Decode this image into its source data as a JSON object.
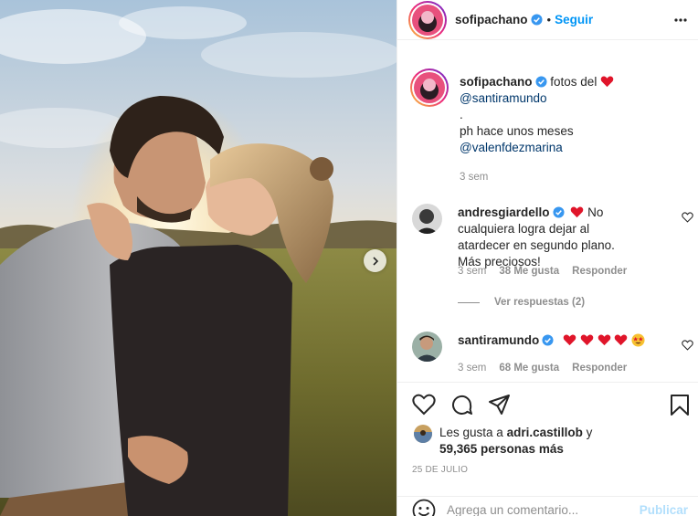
{
  "post": {
    "author": "sofipachano",
    "follow_label": "Seguir",
    "separator": "•"
  },
  "caption": {
    "username": "sofipachano",
    "text_before_emoji": "fotos del",
    "mention1": "@santiramundo",
    "dot": ".",
    "line2": "ph hace unos meses",
    "mention2": "@valenfdezmarina",
    "time": "3 sem"
  },
  "comments": [
    {
      "username": "andresgiardello",
      "text": "No cualquiera logra dejar al atardecer en segundo plano. Más preciosos!",
      "time": "3 sem",
      "likes": "38 Me gusta",
      "reply_label": "Responder"
    },
    {
      "username": "santiramundo",
      "time": "3 sem",
      "likes": "68 Me gusta",
      "reply_label": "Responder"
    }
  ],
  "view_replies": "Ver respuestas (2)",
  "likes_line": {
    "prefix": "Les gusta a",
    "user": "adri.castillob",
    "conj": "y",
    "others": "59,365 personas más"
  },
  "date": "25 DE JULIO",
  "composer": {
    "placeholder": "Agrega un comentario...",
    "publish_label": "Publicar"
  },
  "colors": {
    "verified": "#3897f0",
    "link": "#0095f6",
    "heart_red": "#ed4956"
  },
  "icons": [
    "more-options-icon",
    "verified-icon",
    "heart-icon",
    "comment-icon",
    "share-icon",
    "bookmark-icon",
    "emoji-icon",
    "chevron-right-icon"
  ]
}
